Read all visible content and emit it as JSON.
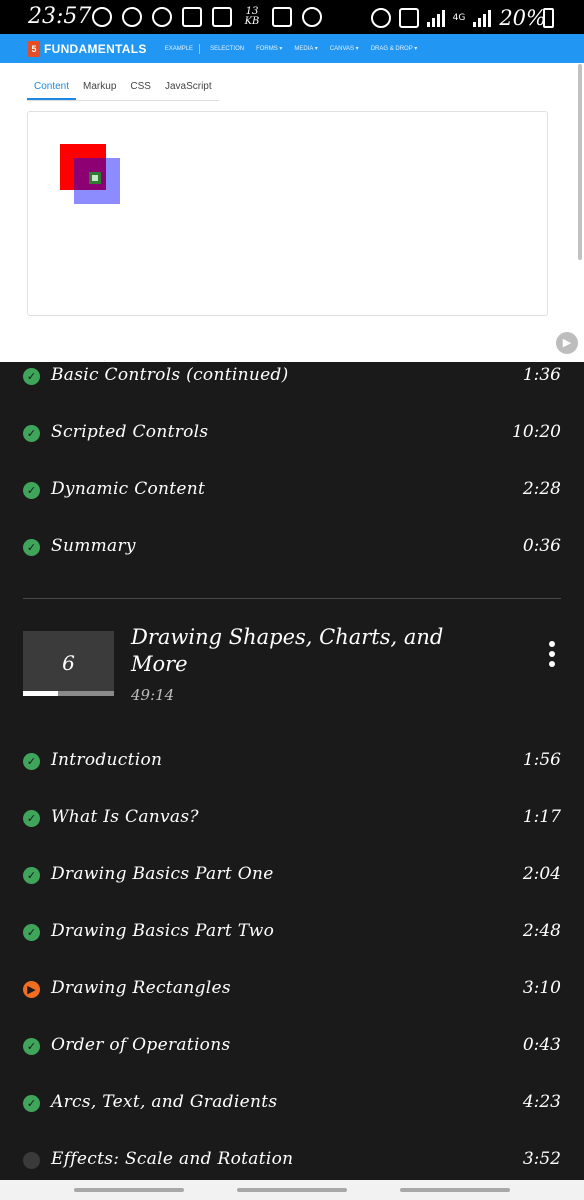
{
  "status_bar": {
    "time": "23:57",
    "data_rate": "13 KB",
    "network": "4G",
    "battery": "20%"
  },
  "app": {
    "logo_badge": "5",
    "brand": "FUNDAMENTALS",
    "nav": [
      "EXAMPLE",
      "SELECTION",
      "FORMS ▾",
      "MEDIA ▾",
      "CANVAS ▾",
      "DRAG & DROP ▾"
    ],
    "tabs": [
      "Content",
      "Markup",
      "CSS",
      "JavaScript"
    ],
    "active_tab": "Content"
  },
  "clips_top": [
    {
      "title": "Basic Controls (continued)",
      "duration": "1:36",
      "status": "done"
    },
    {
      "title": "Scripted Controls",
      "duration": "10:20",
      "status": "done"
    },
    {
      "title": "Dynamic Content",
      "duration": "2:28",
      "status": "done"
    },
    {
      "title": "Summary",
      "duration": "0:36",
      "status": "done"
    }
  ],
  "module": {
    "number": "6",
    "title": "Drawing Shapes, Charts, and More",
    "duration": "49:14",
    "progress": 0.38
  },
  "clips": [
    {
      "title": "Introduction",
      "duration": "1:56",
      "status": "done"
    },
    {
      "title": "What Is Canvas?",
      "duration": "1:17",
      "status": "done"
    },
    {
      "title": "Drawing Basics Part One",
      "duration": "2:04",
      "status": "done"
    },
    {
      "title": "Drawing Basics Part Two",
      "duration": "2:48",
      "status": "done"
    },
    {
      "title": "Drawing Rectangles",
      "duration": "3:10",
      "status": "playing"
    },
    {
      "title": "Order of Operations",
      "duration": "0:43",
      "status": "done"
    },
    {
      "title": "Arcs, Text, and Gradients",
      "duration": "4:23",
      "status": "done"
    },
    {
      "title": "Effects: Scale and Rotation",
      "duration": "3:52",
      "status": "pending"
    }
  ],
  "colors": {
    "accent_blue": "#2196f3",
    "done_green": "#3ea55a",
    "playing_orange": "#f26d21",
    "background": "#1a1a1a"
  }
}
